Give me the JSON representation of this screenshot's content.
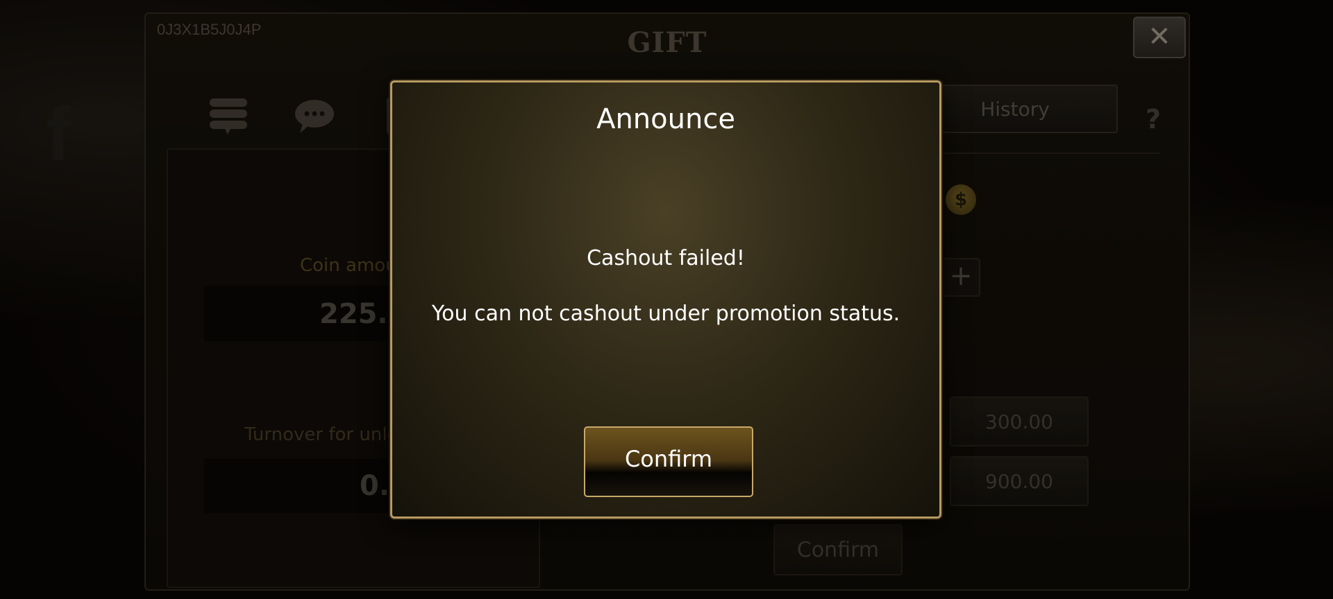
{
  "background": {
    "panel": {
      "user_id": "0J3X1B5J0J4P",
      "title": "GIFT",
      "close_glyph": "✕",
      "history_tab": "History",
      "help_glyph": "?",
      "left": {
        "coin_label": "Coin amoun",
        "coin_value": "225.8",
        "turnover_label": "Turnover for unloc",
        "turnover_value": "0.0"
      },
      "right": {
        "coin_icon_glyph": "$",
        "plus_glyph": "+",
        "amounts": [
          "300.00",
          "900.00"
        ],
        "confirm_label": "Confirm"
      }
    }
  },
  "dialog": {
    "title": "Announce",
    "message_line_1": "Cashout failed!",
    "message_line_2": "You can not cashout under promotion status.",
    "confirm_label": "Confirm"
  },
  "colors": {
    "dialog_border": "#b99a61",
    "button_border": "#c9a96a",
    "text": "#ffffff"
  }
}
